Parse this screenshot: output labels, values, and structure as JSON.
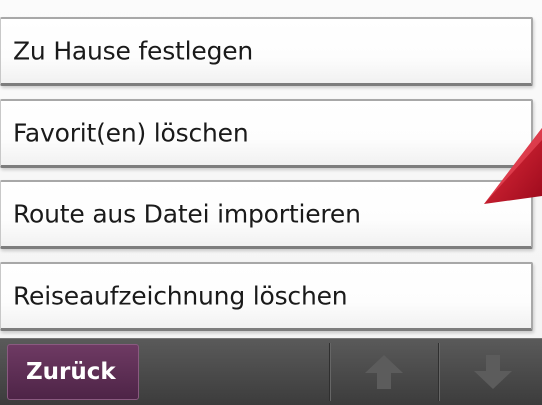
{
  "menu": {
    "items": [
      {
        "label": "Zu Hause festlegen"
      },
      {
        "label": "Favorit(en) löschen"
      },
      {
        "label": "Route aus Datei importieren"
      },
      {
        "label": "Reiseaufzeichnung löschen"
      }
    ]
  },
  "bottom_bar": {
    "back_label": "Zurück",
    "up_icon": "arrow-up-icon",
    "down_icon": "arrow-down-icon"
  },
  "colors": {
    "accent_back_button": "#5e2f55",
    "pointer_red": "#c8102e",
    "bar_background": "#4a4a4a"
  }
}
